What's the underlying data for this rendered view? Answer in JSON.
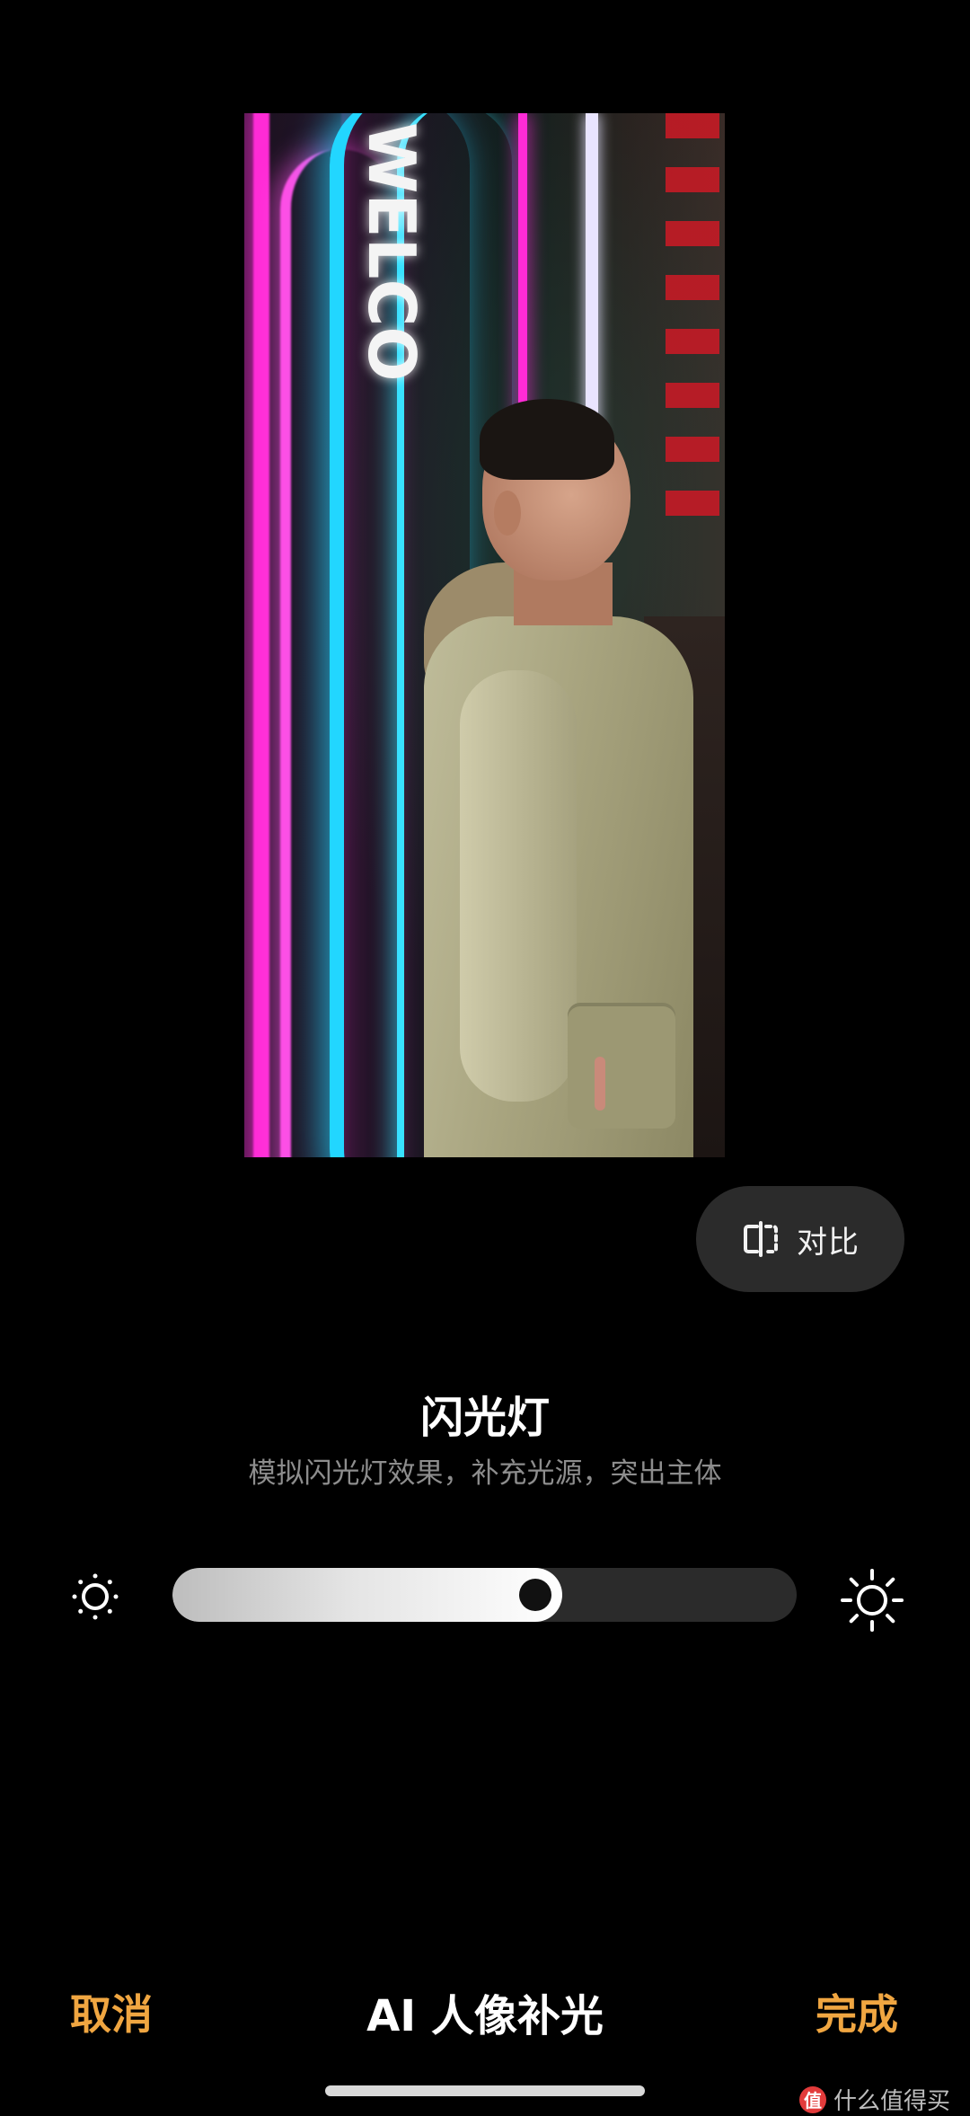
{
  "photo": {
    "neon_text": "WELCO"
  },
  "compare": {
    "label": "对比",
    "icon": "compare-icon"
  },
  "feature": {
    "title": "闪光灯",
    "subtitle": "模拟闪光灯效果，补充光源，突出主体"
  },
  "slider": {
    "value_fraction": 0.625,
    "min_icon": "brightness-low-icon",
    "max_icon": "brightness-high-icon"
  },
  "bottom_bar": {
    "cancel_label": "取消",
    "title": "AI 人像补光",
    "done_label": "完成"
  },
  "watermark": {
    "badge": "值",
    "text": "什么值得买"
  },
  "colors": {
    "accent": "#f0a641",
    "background": "#000000",
    "pill": "#2b2b2b",
    "subtitle": "#8d8d8d"
  }
}
